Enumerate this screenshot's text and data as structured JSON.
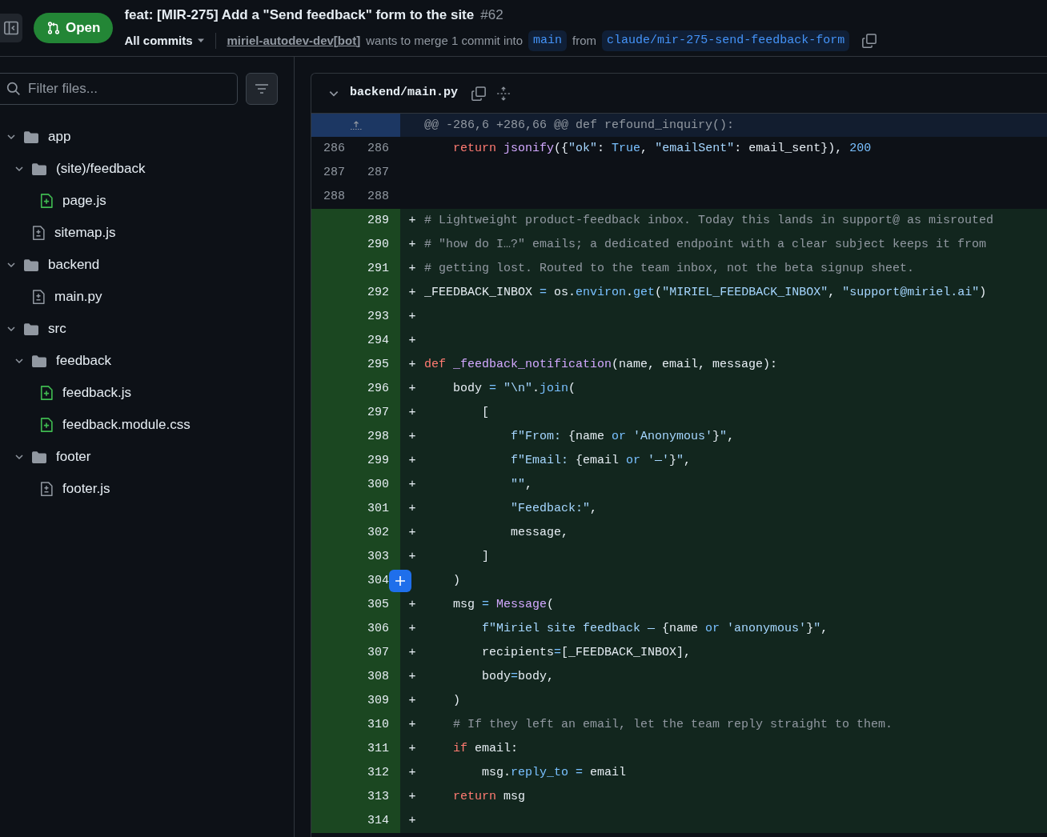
{
  "header": {
    "status": "Open",
    "title": "feat: [MIR-275] Add a \"Send feedback\" form to the site",
    "number": "#62",
    "commits_menu": "All commits",
    "author": "miriel-autodev-dev[bot]",
    "merge_text": "wants to merge 1 commit into",
    "base_branch": "main",
    "from_text": "from",
    "head_branch": "claude/mir-275-send-feedback-form"
  },
  "sidebar": {
    "filter": {
      "placeholder": "Filter files..."
    },
    "tree": [
      {
        "kind": "folder",
        "name": "app",
        "expanded": true,
        "children": [
          {
            "kind": "folder",
            "name": "(site)/feedback",
            "expanded": true,
            "children": [
              {
                "kind": "added",
                "name": "page.js"
              }
            ]
          },
          {
            "kind": "modified",
            "name": "sitemap.js"
          }
        ]
      },
      {
        "kind": "folder",
        "name": "backend",
        "expanded": true,
        "children": [
          {
            "kind": "modified",
            "name": "main.py"
          }
        ]
      },
      {
        "kind": "folder",
        "name": "src",
        "expanded": true,
        "children": [
          {
            "kind": "folder",
            "name": "feedback",
            "expanded": true,
            "children": [
              {
                "kind": "added",
                "name": "feedback.js"
              },
              {
                "kind": "added",
                "name": "feedback.module.css"
              }
            ]
          },
          {
            "kind": "folder",
            "name": "footer",
            "expanded": true,
            "children": [
              {
                "kind": "modified",
                "name": "footer.js"
              }
            ]
          }
        ]
      }
    ]
  },
  "diff": {
    "file": "backend/main.py",
    "expanded": true,
    "hunk": "@@ -286,6 +286,66 @@ def refound_inquiry():",
    "lines": [
      {
        "kind": "context",
        "old": "286",
        "new": "286",
        "hovered": false,
        "tokens": [
          {
            "text": "    return ",
            "kind": "keyword"
          },
          {
            "text": "jsonify",
            "kind": "function"
          },
          {
            "text": "({",
            "kind": "plain"
          },
          {
            "text": "\"ok\"",
            "kind": "string"
          },
          {
            "text": ": ",
            "kind": "plain"
          },
          {
            "text": "True",
            "kind": "constant"
          },
          {
            "text": ", ",
            "kind": "plain"
          },
          {
            "text": "\"emailSent\"",
            "kind": "string"
          },
          {
            "text": ": email_sent}), ",
            "kind": "plain"
          },
          {
            "text": "200",
            "kind": "constant"
          }
        ]
      },
      {
        "kind": "context",
        "old": "287",
        "new": "287",
        "hovered": false
      },
      {
        "kind": "context",
        "old": "288",
        "new": "288",
        "hovered": false
      },
      {
        "kind": "added",
        "new": "289",
        "sign": "+",
        "hovered": false,
        "tokens": [
          {
            "text": "# Lightweight product-feedback inbox. Today this lands in support@ as misrouted",
            "kind": "comment"
          }
        ]
      },
      {
        "kind": "added",
        "new": "290",
        "sign": "+",
        "hovered": false,
        "tokens": [
          {
            "text": "# \"how do I…?\" emails; a dedicated endpoint with a clear subject keeps it from",
            "kind": "comment"
          }
        ]
      },
      {
        "kind": "added",
        "new": "291",
        "sign": "+",
        "hovered": false,
        "tokens": [
          {
            "text": "# getting lost. Routed to the team inbox, not the beta signup sheet.",
            "kind": "comment"
          }
        ]
      },
      {
        "kind": "added",
        "new": "292",
        "sign": "+",
        "hovered": false,
        "tokens": [
          {
            "text": "_FEEDBACK_INBOX ",
            "kind": "plain"
          },
          {
            "text": "=",
            "kind": "constant"
          },
          {
            "text": " os.",
            "kind": "plain"
          },
          {
            "text": "environ",
            "kind": "constant"
          },
          {
            "text": ".",
            "kind": "plain"
          },
          {
            "text": "get",
            "kind": "constant"
          },
          {
            "text": "(",
            "kind": "plain"
          },
          {
            "text": "\"MIRIEL_FEEDBACK_INBOX\"",
            "kind": "string"
          },
          {
            "text": ", ",
            "kind": "plain"
          },
          {
            "text": "\"support@miriel.ai\"",
            "kind": "string"
          },
          {
            "text": ")",
            "kind": "plain"
          }
        ]
      },
      {
        "kind": "added",
        "new": "293",
        "sign": "+",
        "hovered": false
      },
      {
        "kind": "added",
        "new": "294",
        "sign": "+",
        "hovered": false
      },
      {
        "kind": "added",
        "new": "295",
        "sign": "+",
        "hovered": false,
        "tokens": [
          {
            "text": "def ",
            "kind": "keyword"
          },
          {
            "text": "_feedback_notification",
            "kind": "function"
          },
          {
            "text": "(name, email, message):",
            "kind": "plain"
          }
        ]
      },
      {
        "kind": "added",
        "new": "296",
        "sign": "+",
        "hovered": false,
        "tokens": [
          {
            "text": "    body ",
            "kind": "plain"
          },
          {
            "text": "= ",
            "kind": "constant"
          },
          {
            "text": "\"\\n\"",
            "kind": "string"
          },
          {
            "text": ".",
            "kind": "plain"
          },
          {
            "text": "join",
            "kind": "constant"
          },
          {
            "text": "(",
            "kind": "plain"
          }
        ]
      },
      {
        "kind": "added",
        "new": "297",
        "sign": "+",
        "hovered": false,
        "tokens": [
          {
            "text": "        [",
            "kind": "plain"
          }
        ]
      },
      {
        "kind": "added",
        "new": "298",
        "sign": "+",
        "hovered": false,
        "tokens": [
          {
            "text": "            f\"From: ",
            "kind": "string"
          },
          {
            "text": "{name ",
            "kind": "plain"
          },
          {
            "text": "or ",
            "kind": "constant"
          },
          {
            "text": "'Anonymous'",
            "kind": "string"
          },
          {
            "text": "}",
            "kind": "plain"
          },
          {
            "text": "\"",
            "kind": "string"
          },
          {
            "text": ",",
            "kind": "plain"
          }
        ]
      },
      {
        "kind": "added",
        "new": "299",
        "sign": "+",
        "hovered": false,
        "tokens": [
          {
            "text": "            f\"Email: ",
            "kind": "string"
          },
          {
            "text": "{email ",
            "kind": "plain"
          },
          {
            "text": "or ",
            "kind": "constant"
          },
          {
            "text": "'—'",
            "kind": "string"
          },
          {
            "text": "}",
            "kind": "plain"
          },
          {
            "text": "\"",
            "kind": "string"
          },
          {
            "text": ",",
            "kind": "plain"
          }
        ]
      },
      {
        "kind": "added",
        "new": "300",
        "sign": "+",
        "hovered": false,
        "tokens": [
          {
            "text": "            \"\"",
            "kind": "string"
          },
          {
            "text": ",",
            "kind": "plain"
          }
        ]
      },
      {
        "kind": "added",
        "new": "301",
        "sign": "+",
        "hovered": false,
        "tokens": [
          {
            "text": "            \"Feedback:\"",
            "kind": "string"
          },
          {
            "text": ",",
            "kind": "plain"
          }
        ]
      },
      {
        "kind": "added",
        "new": "302",
        "sign": "+",
        "hovered": false,
        "tokens": [
          {
            "text": "            message,",
            "kind": "plain"
          }
        ]
      },
      {
        "kind": "added",
        "new": "303",
        "sign": "+",
        "hovered": false,
        "tokens": [
          {
            "text": "        ]",
            "kind": "plain"
          }
        ]
      },
      {
        "kind": "added",
        "new": "304",
        "hovered": true,
        "tokens": [
          {
            "text": "    )",
            "kind": "plain"
          }
        ]
      },
      {
        "kind": "added",
        "new": "305",
        "sign": "+",
        "hovered": false,
        "tokens": [
          {
            "text": "    msg ",
            "kind": "plain"
          },
          {
            "text": "= ",
            "kind": "constant"
          },
          {
            "text": "Message",
            "kind": "function"
          },
          {
            "text": "(",
            "kind": "plain"
          }
        ]
      },
      {
        "kind": "added",
        "new": "306",
        "sign": "+",
        "hovered": false,
        "tokens": [
          {
            "text": "        f\"Miriel site feedback — ",
            "kind": "string"
          },
          {
            "text": "{name ",
            "kind": "plain"
          },
          {
            "text": "or ",
            "kind": "constant"
          },
          {
            "text": "'anonymous'",
            "kind": "string"
          },
          {
            "text": "}",
            "kind": "plain"
          },
          {
            "text": "\"",
            "kind": "string"
          },
          {
            "text": ",",
            "kind": "plain"
          }
        ]
      },
      {
        "kind": "added",
        "new": "307",
        "sign": "+",
        "hovered": false,
        "tokens": [
          {
            "text": "        recipients",
            "kind": "plain"
          },
          {
            "text": "=",
            "kind": "constant"
          },
          {
            "text": "[_FEEDBACK_INBOX],",
            "kind": "plain"
          }
        ]
      },
      {
        "kind": "added",
        "new": "308",
        "sign": "+",
        "hovered": false,
        "tokens": [
          {
            "text": "        body",
            "kind": "plain"
          },
          {
            "text": "=",
            "kind": "constant"
          },
          {
            "text": "body,",
            "kind": "plain"
          }
        ]
      },
      {
        "kind": "added",
        "new": "309",
        "sign": "+",
        "hovered": false,
        "tokens": [
          {
            "text": "    )",
            "kind": "plain"
          }
        ]
      },
      {
        "kind": "added",
        "new": "310",
        "sign": "+",
        "hovered": false,
        "tokens": [
          {
            "text": "    # If they left an email, let the team reply straight to them.",
            "kind": "comment"
          }
        ]
      },
      {
        "kind": "added",
        "new": "311",
        "sign": "+",
        "hovered": false,
        "tokens": [
          {
            "text": "    if",
            "kind": "keyword"
          },
          {
            "text": " email:",
            "kind": "plain"
          }
        ]
      },
      {
        "kind": "added",
        "new": "312",
        "sign": "+",
        "hovered": false,
        "tokens": [
          {
            "text": "        msg.",
            "kind": "plain"
          },
          {
            "text": "reply_to",
            "kind": "constant"
          },
          {
            "text": " = ",
            "kind": "constant"
          },
          {
            "text": "email",
            "kind": "plain"
          }
        ]
      },
      {
        "kind": "added",
        "new": "313",
        "sign": "+",
        "hovered": false,
        "tokens": [
          {
            "text": "    return",
            "kind": "keyword"
          },
          {
            "text": " msg",
            "kind": "plain"
          }
        ]
      },
      {
        "kind": "added",
        "new": "314",
        "sign": "+",
        "hovered": false
      }
    ]
  }
}
